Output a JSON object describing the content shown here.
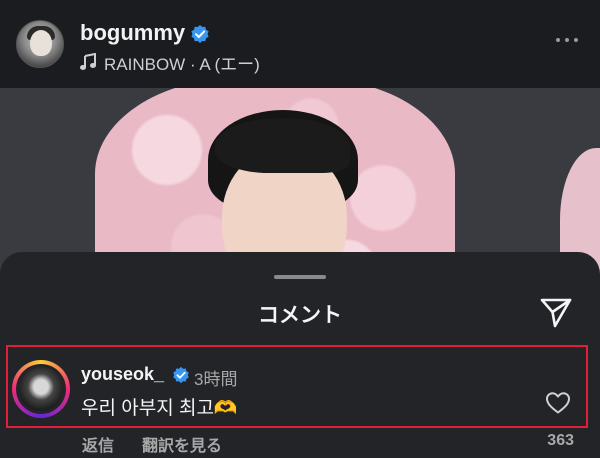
{
  "post": {
    "username": "bogummy",
    "music": "RAINBOW · A (エー)"
  },
  "sheet": {
    "title": "コメント"
  },
  "comment": {
    "username": "youseok_",
    "time": "3時間",
    "text": "우리 아부지 최고🫶",
    "reply_label": "返信",
    "translate_label": "翻訳を見る",
    "like_count": "363"
  },
  "colors": {
    "verified": "#3797f0",
    "highlight_border": "#e0203a",
    "sheet_bg": "#222428"
  },
  "icons": [
    "verified-icon",
    "music-note-icon",
    "more-icon",
    "share-icon",
    "heart-icon"
  ]
}
